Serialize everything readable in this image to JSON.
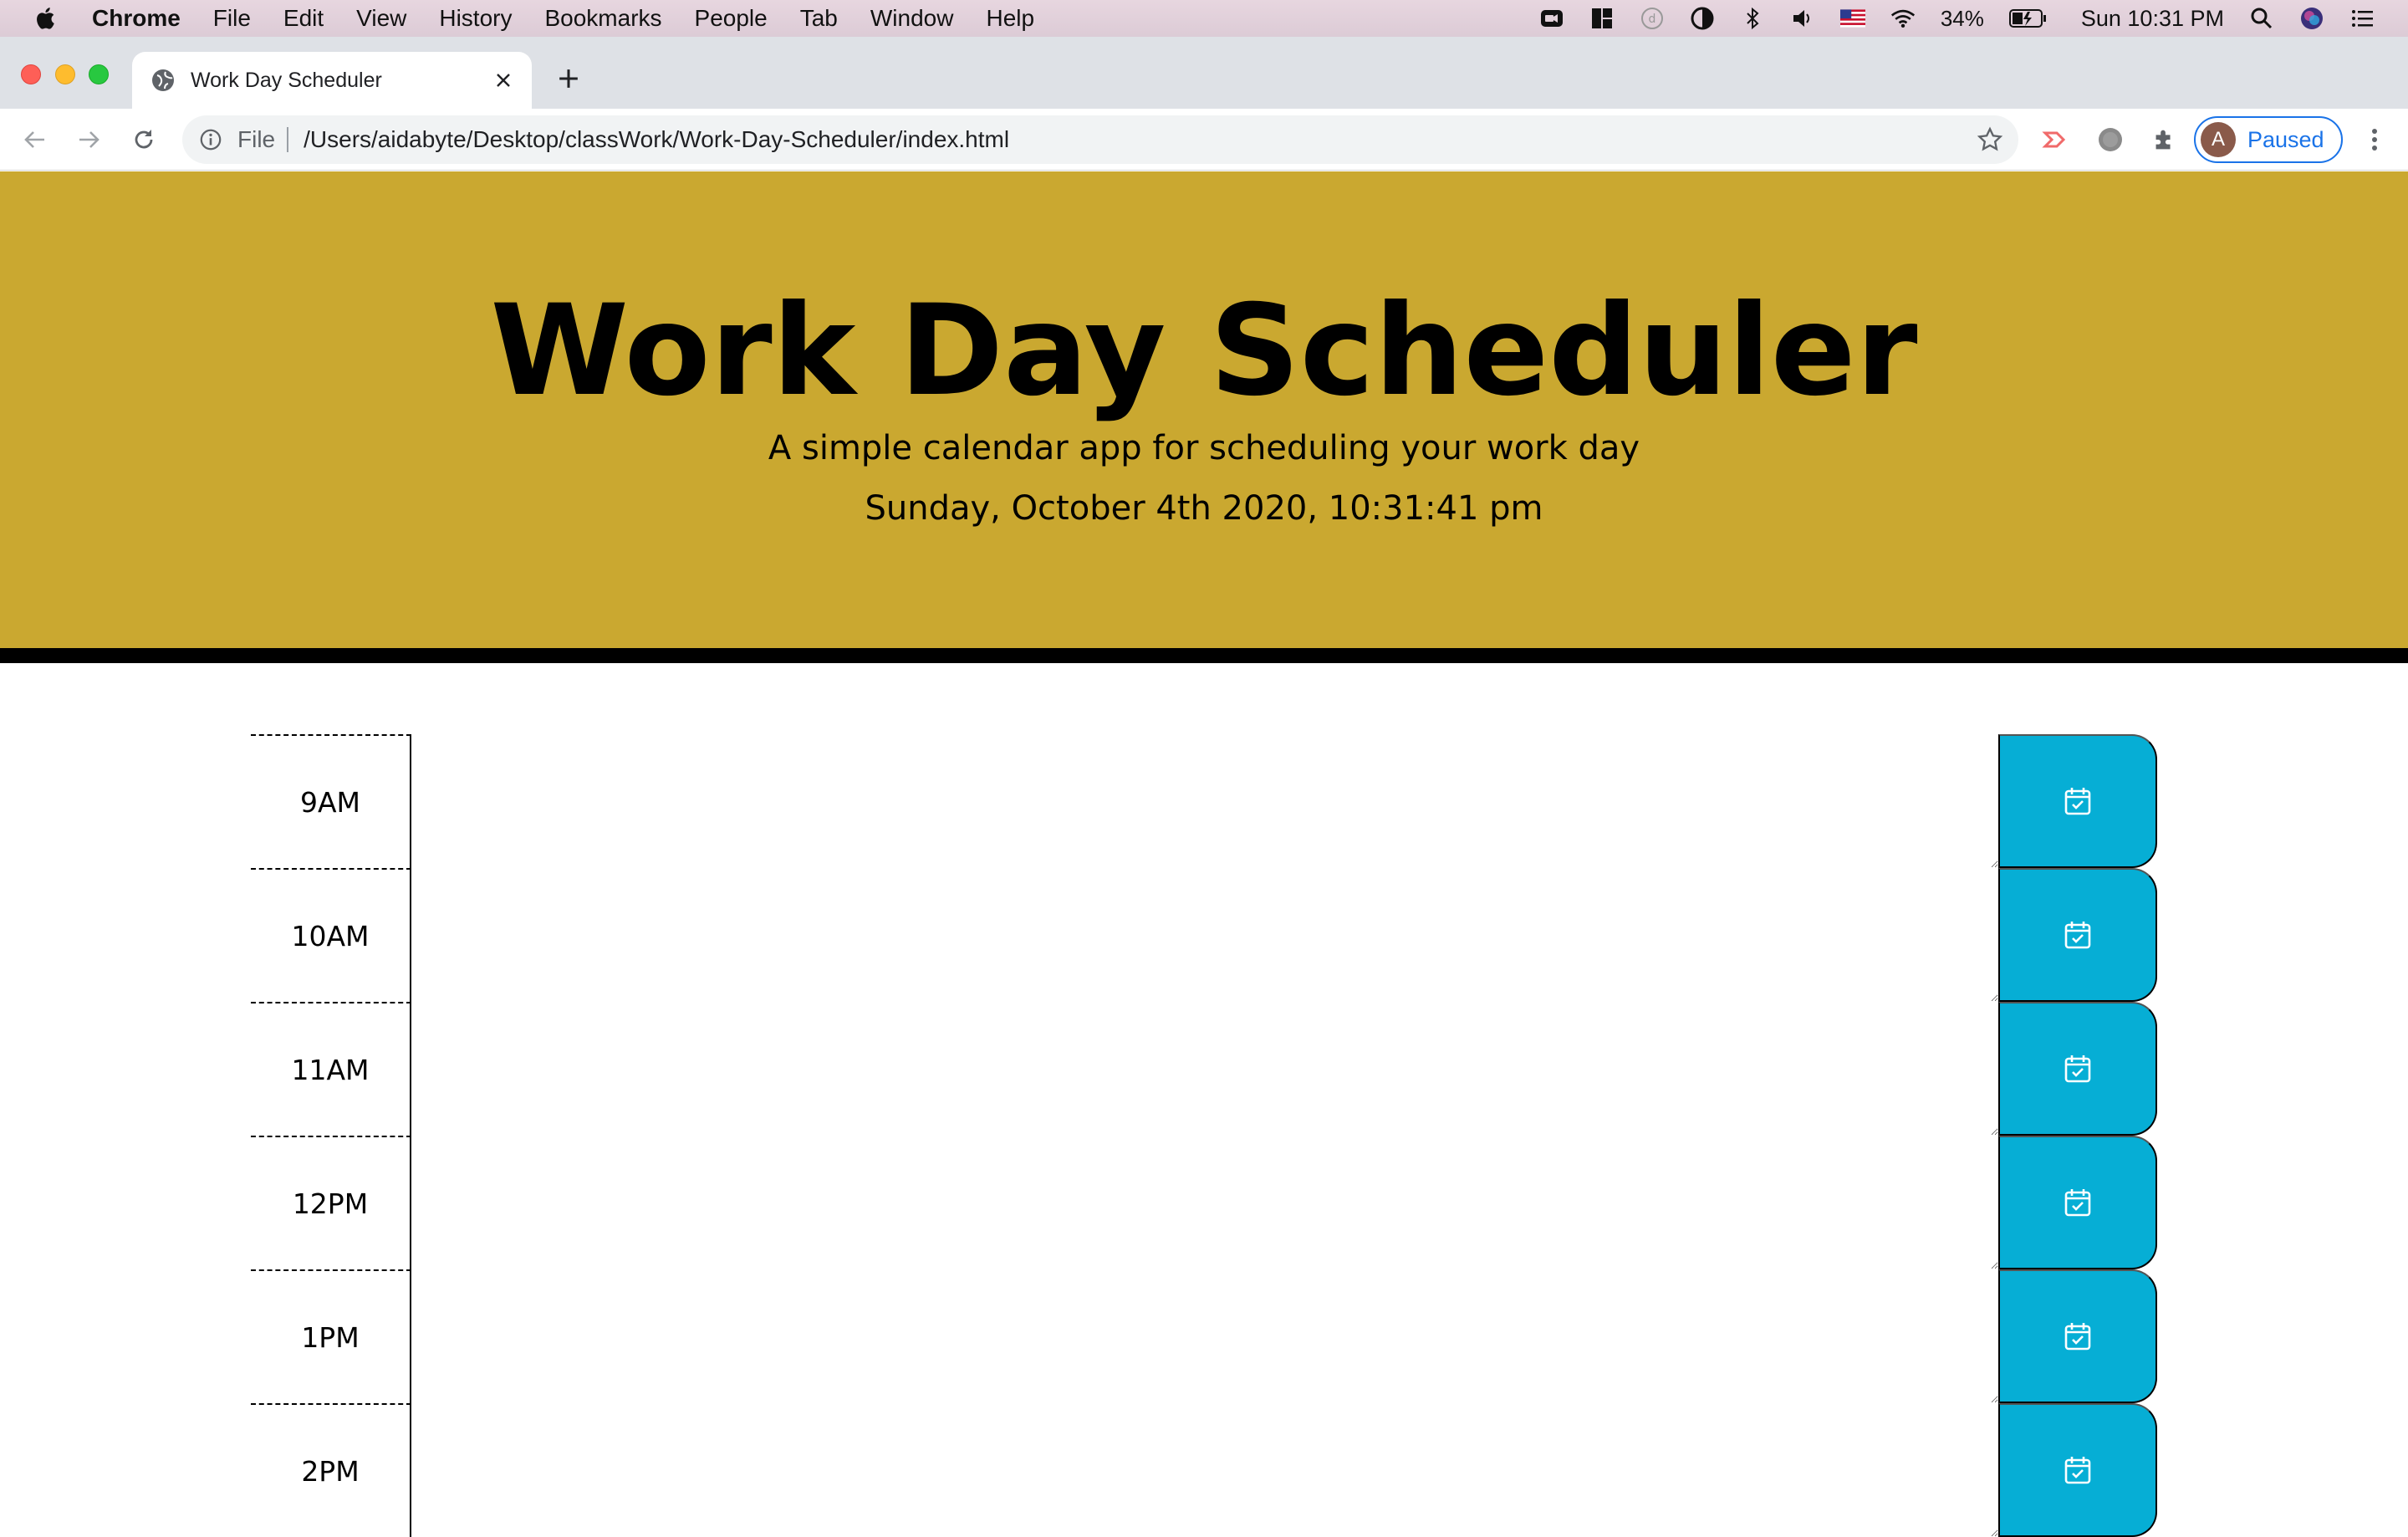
{
  "menubar": {
    "app": "Chrome",
    "items": [
      "File",
      "Edit",
      "View",
      "History",
      "Bookmarks",
      "People",
      "Tab",
      "Window",
      "Help"
    ],
    "battery": "34%",
    "clock": "Sun 10:31 PM"
  },
  "browser": {
    "tab_title": "Work Day Scheduler",
    "scheme": "File",
    "url": "/Users/aidabyte/Desktop/classWork/Work-Day-Scheduler/index.html",
    "profile_initial": "A",
    "profile_status": "Paused"
  },
  "page": {
    "title": "Work Day Scheduler",
    "lead": "A simple calendar app for scheduling your work day",
    "current_date": "Sunday, October 4th 2020, 10:31:41 pm"
  },
  "schedule": {
    "rows": [
      {
        "hour": "9AM",
        "text": ""
      },
      {
        "hour": "10AM",
        "text": ""
      },
      {
        "hour": "11AM",
        "text": ""
      },
      {
        "hour": "12PM",
        "text": ""
      },
      {
        "hour": "1PM",
        "text": ""
      },
      {
        "hour": "2PM",
        "text": ""
      }
    ]
  },
  "colors": {
    "jumbotron": "#caa830",
    "save_button": "#06aed5",
    "profile_accent": "#1a73e8"
  },
  "icons": {
    "save": "calendar-check-icon"
  }
}
